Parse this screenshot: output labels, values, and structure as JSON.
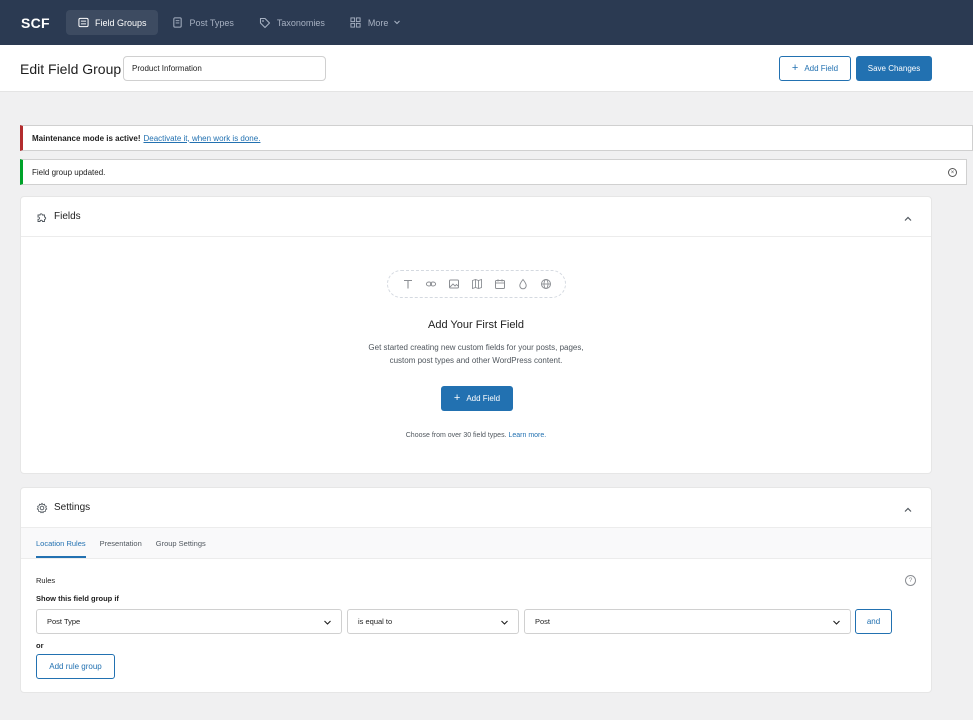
{
  "nav": {
    "brand": "SCF",
    "tabs": [
      {
        "label": "Field Groups",
        "icon": "list-icon"
      },
      {
        "label": "Post Types",
        "icon": "document-icon"
      },
      {
        "label": "Taxonomies",
        "icon": "tag-icon"
      },
      {
        "label": "More",
        "icon": "grid-icon"
      }
    ]
  },
  "header": {
    "title": "Edit Field Group",
    "group_name_value": "Product Information",
    "add_field_label": "Add Field",
    "save_label": "Save Changes"
  },
  "notices": {
    "maintenance_bold": "Maintenance mode is active!",
    "maintenance_link": "Deactivate it, when work is done.",
    "updated": "Field group updated."
  },
  "fields_panel": {
    "title": "Fields",
    "empty_title": "Add Your First Field",
    "empty_desc_line1": "Get started creating new custom fields for your posts, pages,",
    "empty_desc_line2": "custom post types and other WordPress content.",
    "add_field_label": "Add Field",
    "choose_text": "Choose from over 30 field types.",
    "learn_more": "Learn more.",
    "field_type_icons": [
      "text-icon",
      "link-icon",
      "image-icon",
      "map-icon",
      "date-icon",
      "color-icon",
      "url-icon"
    ]
  },
  "settings_panel": {
    "title": "Settings",
    "tabs": [
      "Location Rules",
      "Presentation",
      "Group Settings"
    ],
    "rules_label": "Rules",
    "show_if_label": "Show this field group if",
    "param_value": "Post Type",
    "operator_value": "is equal to",
    "value_value": "Post",
    "and_label": "and",
    "or_label": "or",
    "add_rule_group_label": "Add rule group"
  },
  "colors": {
    "nav_bg": "#2b3a52",
    "accent": "#2271b1",
    "maintenance_border": "#b32d2e",
    "success_border": "#00a32a"
  }
}
